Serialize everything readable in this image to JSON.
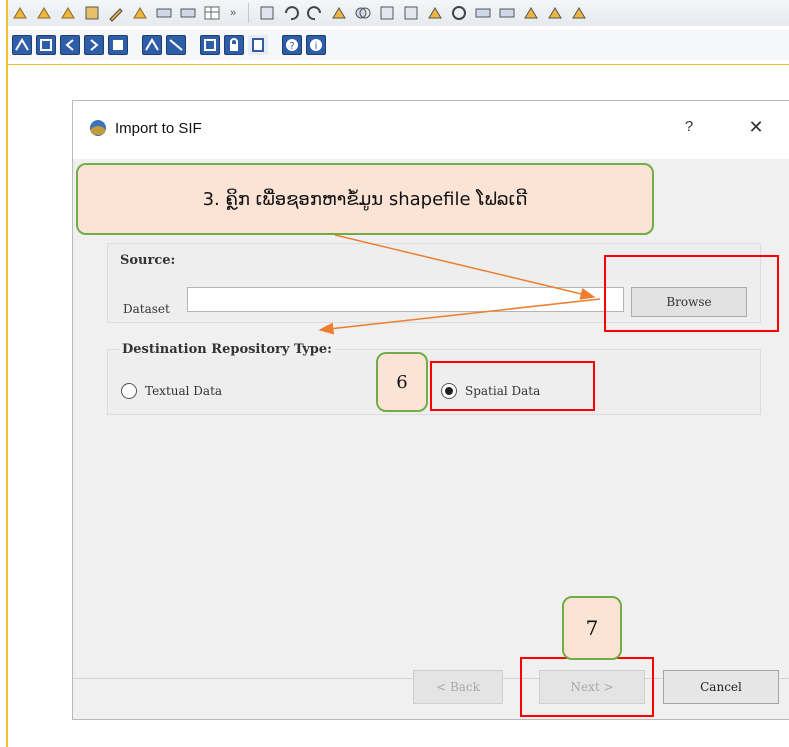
{
  "window": {
    "title": "Import to SIF",
    "help_label": "?",
    "close_label": "✕"
  },
  "source_group": {
    "title": "Source:",
    "dataset_label": "Dataset",
    "dataset_value": "",
    "browse_label": "Browse"
  },
  "destination_group": {
    "title": "Destination Repository Type:",
    "options": [
      {
        "label": "Textual Data",
        "selected": false
      },
      {
        "label": "Spatial Data",
        "selected": true
      }
    ]
  },
  "footer": {
    "back_label": "< Back",
    "next_label": "Next >",
    "cancel_label": "Cancel"
  },
  "annotations": {
    "callout_main": "3. ຄຼິກ ເພື່ອຊອກຫາຂໍ້ມູນ shapefile ໂຟລເດີ",
    "callout_6": "6",
    "callout_7": "7"
  },
  "colors": {
    "annotation_fill": "#fbe4d5",
    "annotation_border": "#70ad47",
    "highlight_red": "#ff0000",
    "arrow_orange": "#ed7d31",
    "app_frame": "#f2c230"
  },
  "toolbar_row1_icons": [
    "layer-icon",
    "layer-icon",
    "layer-icon",
    "layer-icon",
    "layer-icon",
    "layer-icon",
    "layer-icon",
    "layer-icon",
    "table-icon"
  ],
  "toolbar_row2_icons": [
    "map-icon",
    "grid-icon",
    "back-icon",
    "forward-icon",
    "save-icon",
    "map-icon",
    "map-icon",
    "crop-icon",
    "lock-icon",
    "page-icon",
    "help-icon",
    "info-icon"
  ]
}
